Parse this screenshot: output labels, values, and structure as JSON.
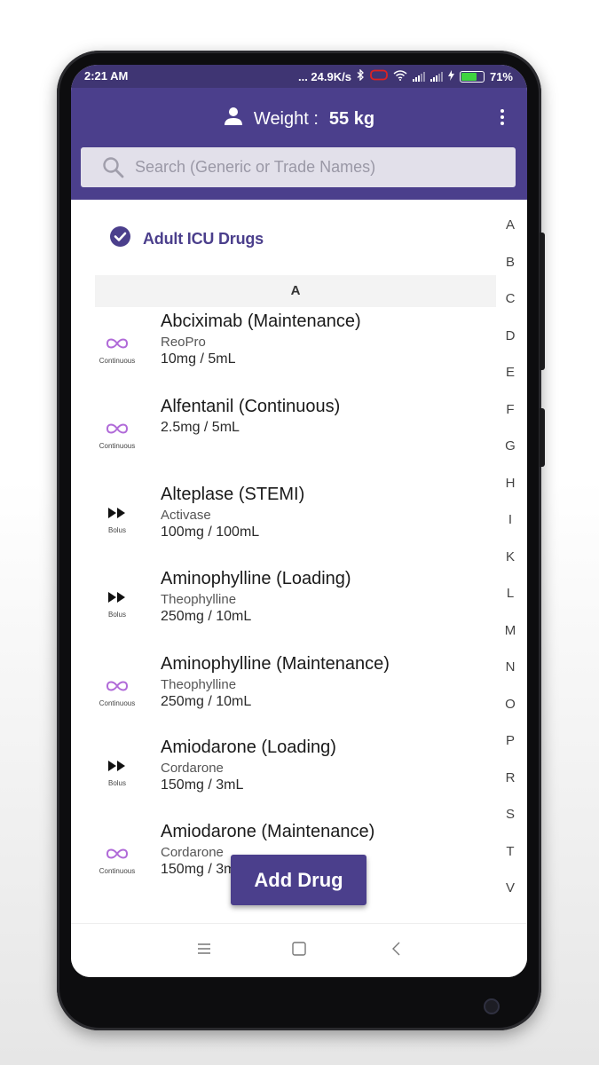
{
  "status_bar": {
    "time": "2:21 AM",
    "network_speed": "... 24.9K/s",
    "battery_percent": "71%",
    "battery_level": 0.71
  },
  "header": {
    "weight_label": "Weight :",
    "weight_value": "55 kg"
  },
  "search": {
    "placeholder": "Search (Generic or Trade Names)"
  },
  "category": {
    "label": "Adult ICU Drugs"
  },
  "section": {
    "letter": "A"
  },
  "drugs": [
    {
      "type": "Continuous",
      "icon": "infinity-icon",
      "name": "Abciximab (Maintenance)",
      "trade": "ReoPro",
      "concentration": "10mg / 5mL"
    },
    {
      "type": "Continuous",
      "icon": "infinity-icon",
      "name": "Alfentanil (Continuous)",
      "trade": "",
      "concentration": "2.5mg / 5mL"
    },
    {
      "type": "Bolus",
      "icon": "fast-forward-icon",
      "name": "Alteplase (STEMI)",
      "trade": "Activase",
      "concentration": "100mg / 100mL"
    },
    {
      "type": "Bolus",
      "icon": "fast-forward-icon",
      "name": "Aminophylline (Loading)",
      "trade": "Theophylline",
      "concentration": "250mg / 10mL"
    },
    {
      "type": "Continuous",
      "icon": "infinity-icon",
      "name": "Aminophylline (Maintenance)",
      "trade": "Theophylline",
      "concentration": "250mg / 10mL"
    },
    {
      "type": "Bolus",
      "icon": "fast-forward-icon",
      "name": "Amiodarone (Loading)",
      "trade": "Cordarone",
      "concentration": "150mg / 3mL"
    },
    {
      "type": "Continuous",
      "icon": "infinity-icon",
      "name": "Amiodarone (Maintenance)",
      "trade": "Cordarone",
      "concentration": "150mg / 3mL"
    }
  ],
  "alphabet_index": [
    "A",
    "B",
    "C",
    "D",
    "E",
    "F",
    "G",
    "H",
    "I",
    "K",
    "L",
    "M",
    "N",
    "O",
    "P",
    "R",
    "S",
    "T",
    "V"
  ],
  "fab": {
    "label": "Add Drug"
  },
  "colors": {
    "primary": "#4b3f8c",
    "status_bar": "#3f3573",
    "continuous_icon": "#b06ad8",
    "battery": "#3fd43f"
  }
}
